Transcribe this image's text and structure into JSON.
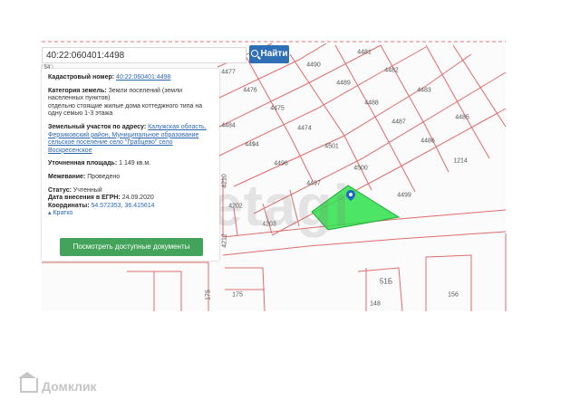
{
  "search": {
    "value": "40:22:060401:4498",
    "button_label": "Найти"
  },
  "small_label": "54",
  "card": {
    "cad_label": "Кадастровый номер:",
    "cad_value": "40:22:060401:4498",
    "cat_label": "Категория земель:",
    "cat_value": "Земли поселений (земли населенных пунктов)",
    "use_value": "отдельно стоящие жилые дома коттеджного типа на одну семью 1-3 этажа",
    "addr_label": "Земельный участок по адресу:",
    "addr_value": "Калужская область, Ферзиковский район, Муниципальное образование сельское поселение село \"Грабцево\" село Воскресенское",
    "area_label": "Уточненная площадь:",
    "area_value": "1 149 кв.м.",
    "border_label": "Межевание:",
    "border_value": "Проведено",
    "status_label": "Статус:",
    "status_value": "Учтенный",
    "date_label": "Дата внесения в ЕГРН:",
    "date_value": "24.09.2020",
    "coords_label": "Координаты:",
    "coords_value": "54.572353, 36.415614",
    "short_link": "Кратко",
    "docs_button": "Посмотреть доступные документы"
  },
  "plots": [
    "4477",
    "4476",
    "4475",
    "4474",
    "4484",
    "4494",
    "4501",
    "4496",
    "4497",
    "4500",
    "4499",
    "4202",
    "4203",
    "4490",
    "4481",
    "4482",
    "4489",
    "4488",
    "4483",
    "4487",
    "4485",
    "4486",
    "1214",
    "4210",
    "4212",
    "175",
    "51Б",
    "148",
    "156"
  ],
  "watermark": "etagi",
  "logo": "Домклик",
  "colors": {
    "accent": "#2f6fb5",
    "docs_button": "#44a35b",
    "highlight": "#2ee04a",
    "boundary": "#e06b6b"
  }
}
